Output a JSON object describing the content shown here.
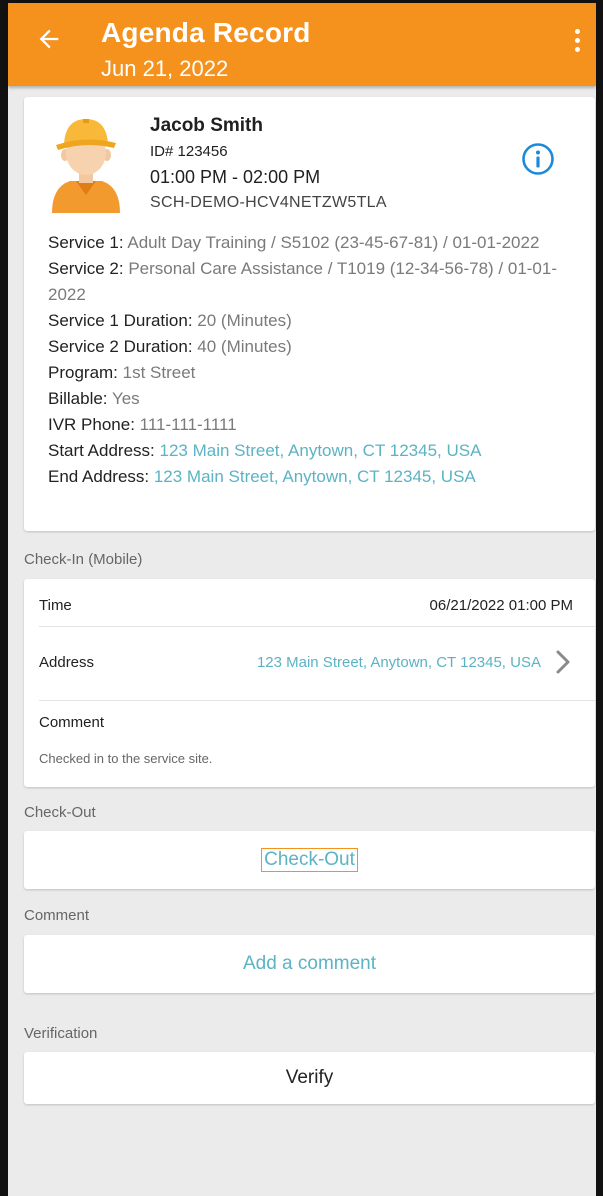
{
  "appbar": {
    "title": "Agenda Record",
    "date": "Jun 21, 2022",
    "color": "#f5921e"
  },
  "client": {
    "name": "Jacob Smith",
    "id": "ID# 123456",
    "time": "01:00 PM - 02:00 PM",
    "code": "SCH-DEMO-HCV4NETZW5TLA"
  },
  "details": {
    "service1_label": "Service 1: ",
    "service1_value": "Adult Day Training / S5102 (23-45-67-81) / 01-01-2022",
    "service2_label": "Service 2: ",
    "service2_value": "Personal Care Assistance / T1019 (12-34-56-78) / 01-01-2022",
    "service1_duration_label": "Service 1 Duration: ",
    "service1_duration_value": "20 (Minutes)",
    "service2_duration_label": "Service 2 Duration: ",
    "service2_duration_value": "40 (Minutes)",
    "program_label": "Program: ",
    "program_value": "1st Street",
    "billable_label": "Billable: ",
    "billable_value": "Yes",
    "ivr_label": "IVR Phone: ",
    "ivr_value": "111-111-1111",
    "start_label": "Start Address: ",
    "start_value": "123 Main Street, Anytown, CT 12345, USA",
    "end_label": "End Address: ",
    "end_value": "123 Main Street, Anytown, CT 12345, USA"
  },
  "checkin": {
    "section": "Check-In (Mobile)",
    "time_label": "Time",
    "time_value": "06/21/2022 01:00 PM",
    "address_label": "Address",
    "address_value": "123 Main Street, Anytown, CT 12345, USA",
    "comment_label": "Comment",
    "comment_value": "Checked in to the service site."
  },
  "checkout": {
    "section": "Check-Out",
    "button": "Check-Out"
  },
  "comment": {
    "section": "Comment",
    "button": "Add a comment"
  },
  "verification": {
    "section": "Verification",
    "button": "Verify"
  },
  "colors": {
    "accent": "#f5921e",
    "link": "#5bb3c4",
    "background": "#ebebeb"
  },
  "icons": {
    "back": "arrow-left-icon",
    "menu": "more-vertical-icon",
    "info": "info-circle-icon",
    "chevron": "chevron-right-icon",
    "avatar": "worker-avatar-icon"
  }
}
